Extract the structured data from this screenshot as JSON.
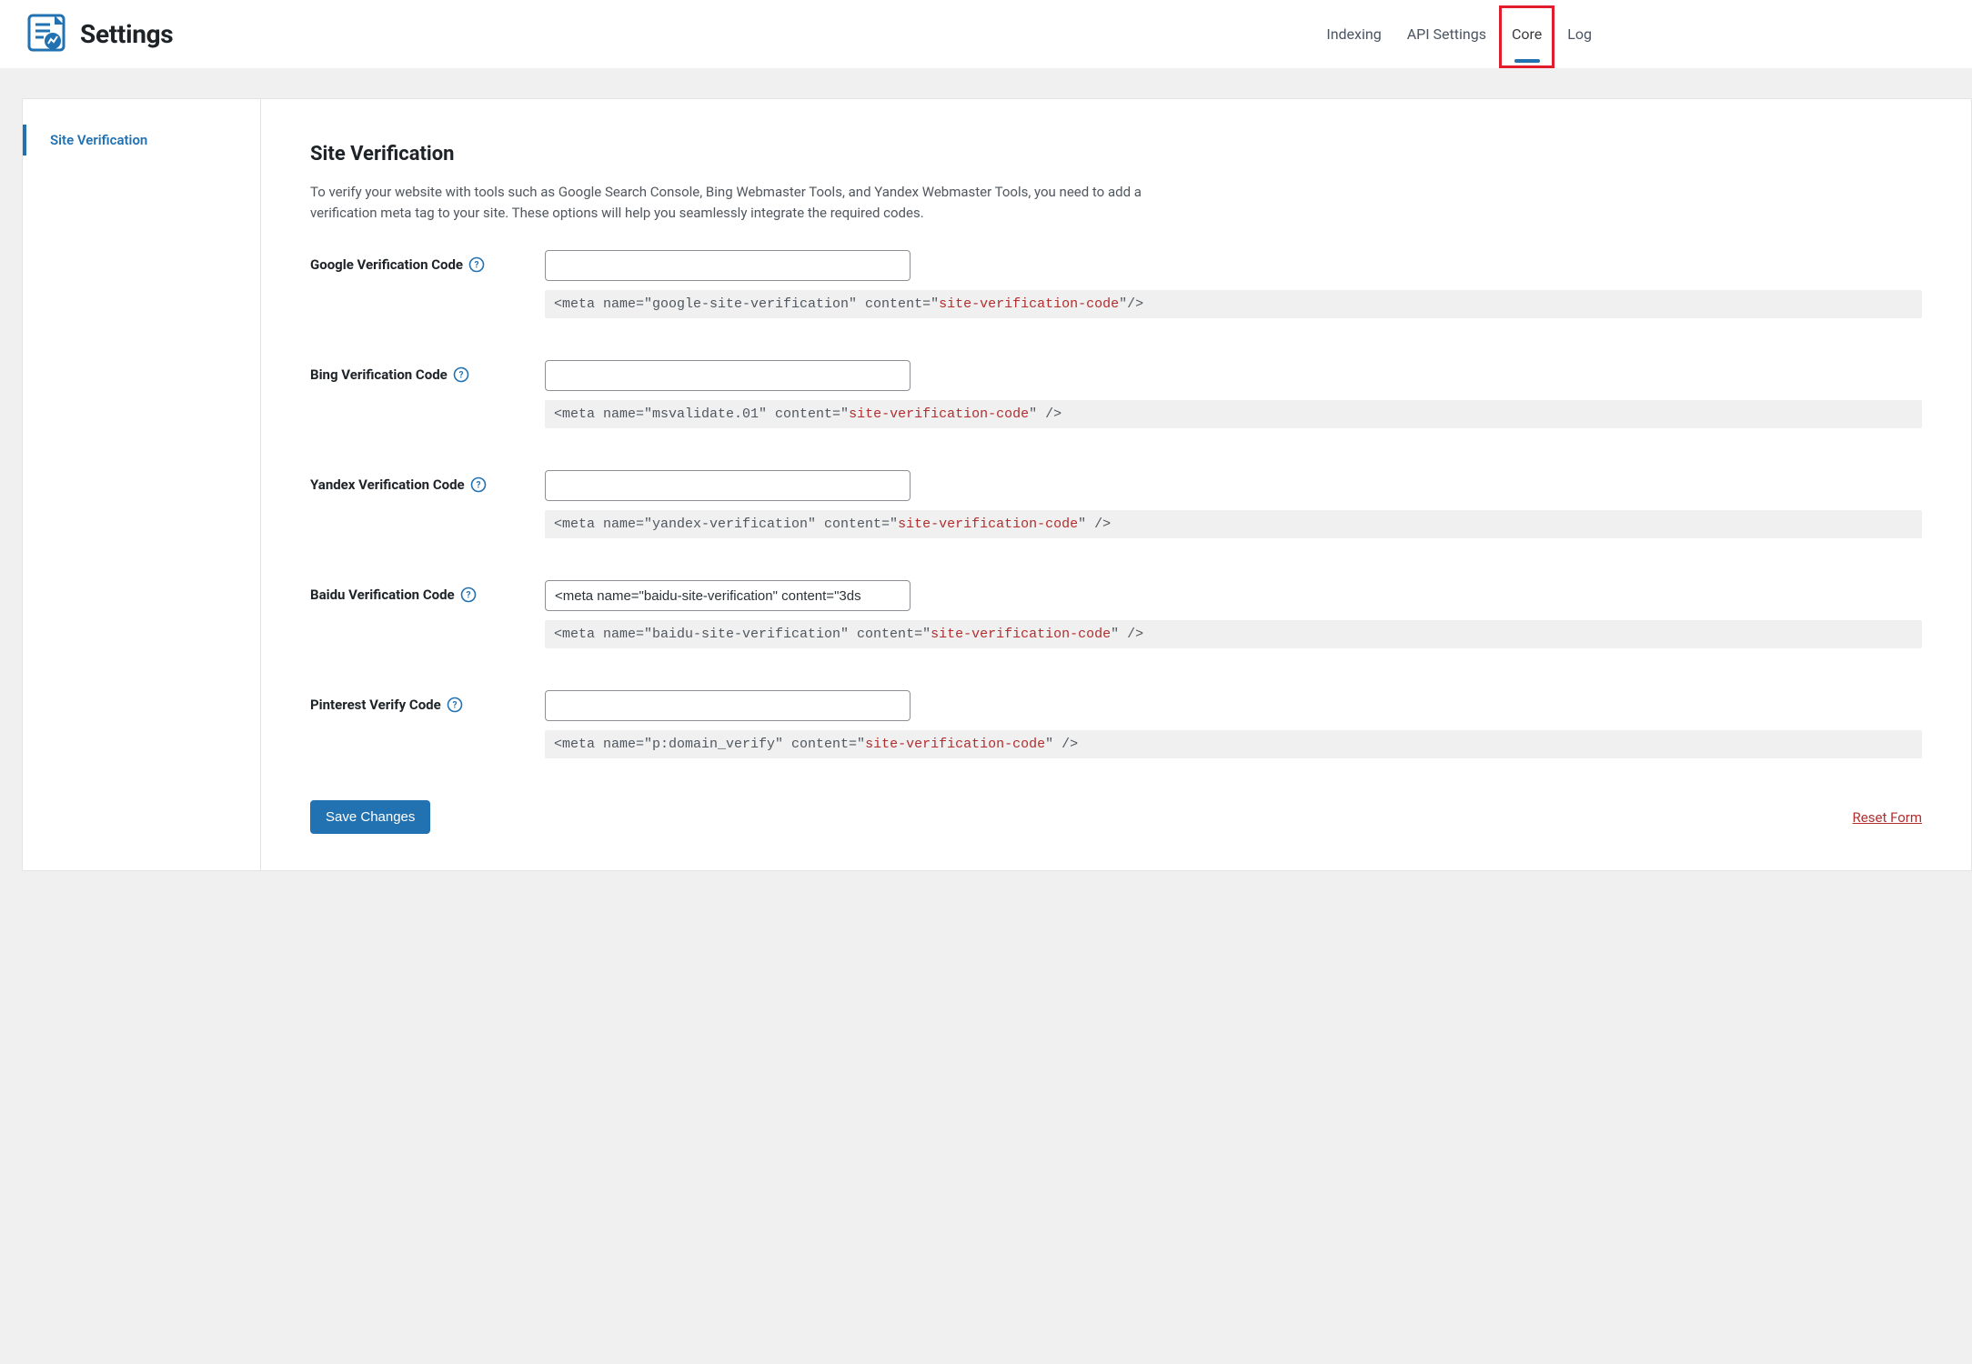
{
  "header": {
    "title": "Settings",
    "tabs": [
      {
        "label": "Indexing",
        "active": false,
        "highlight": false
      },
      {
        "label": "API Settings",
        "active": false,
        "highlight": false
      },
      {
        "label": "Core",
        "active": true,
        "highlight": true
      },
      {
        "label": "Log",
        "active": false,
        "highlight": false
      }
    ]
  },
  "sidebar": {
    "items": [
      {
        "label": "Site Verification",
        "active": true
      }
    ]
  },
  "section": {
    "title": "Site Verification",
    "description": "To verify your website with tools such as Google Search Console, Bing Webmaster Tools, and Yandex Webmaster Tools, you need to add a verification meta tag to your site. These options will help you seamlessly integrate the required codes."
  },
  "fields": [
    {
      "key": "google",
      "label": "Google Verification Code",
      "value": "",
      "hint_pre": "<meta name=\"google-site-verification\" content=\"",
      "hint_hl": "site-verification-code",
      "hint_post": "\"/>"
    },
    {
      "key": "bing",
      "label": "Bing Verification Code",
      "value": "",
      "hint_pre": "<meta name=\"msvalidate.01\" content=\"",
      "hint_hl": "site-verification-code",
      "hint_post": "\" />"
    },
    {
      "key": "yandex",
      "label": "Yandex Verification Code",
      "value": "",
      "hint_pre": "<meta name=\"yandex-verification\" content=\"",
      "hint_hl": "site-verification-code",
      "hint_post": "\" />"
    },
    {
      "key": "baidu",
      "label": "Baidu Verification Code",
      "value": "<meta name=\"baidu-site-verification\" content=\"3ds",
      "hint_pre": "<meta name=\"baidu-site-verification\" content=\"",
      "hint_hl": "site-verification-code",
      "hint_post": "\" />"
    },
    {
      "key": "pinterest",
      "label": "Pinterest Verify Code",
      "value": "",
      "hint_pre": "<meta name=\"p:domain_verify\" content=\"",
      "hint_hl": "site-verification-code",
      "hint_post": "\" />"
    }
  ],
  "actions": {
    "save_label": "Save Changes",
    "reset_label": "Reset Form"
  }
}
